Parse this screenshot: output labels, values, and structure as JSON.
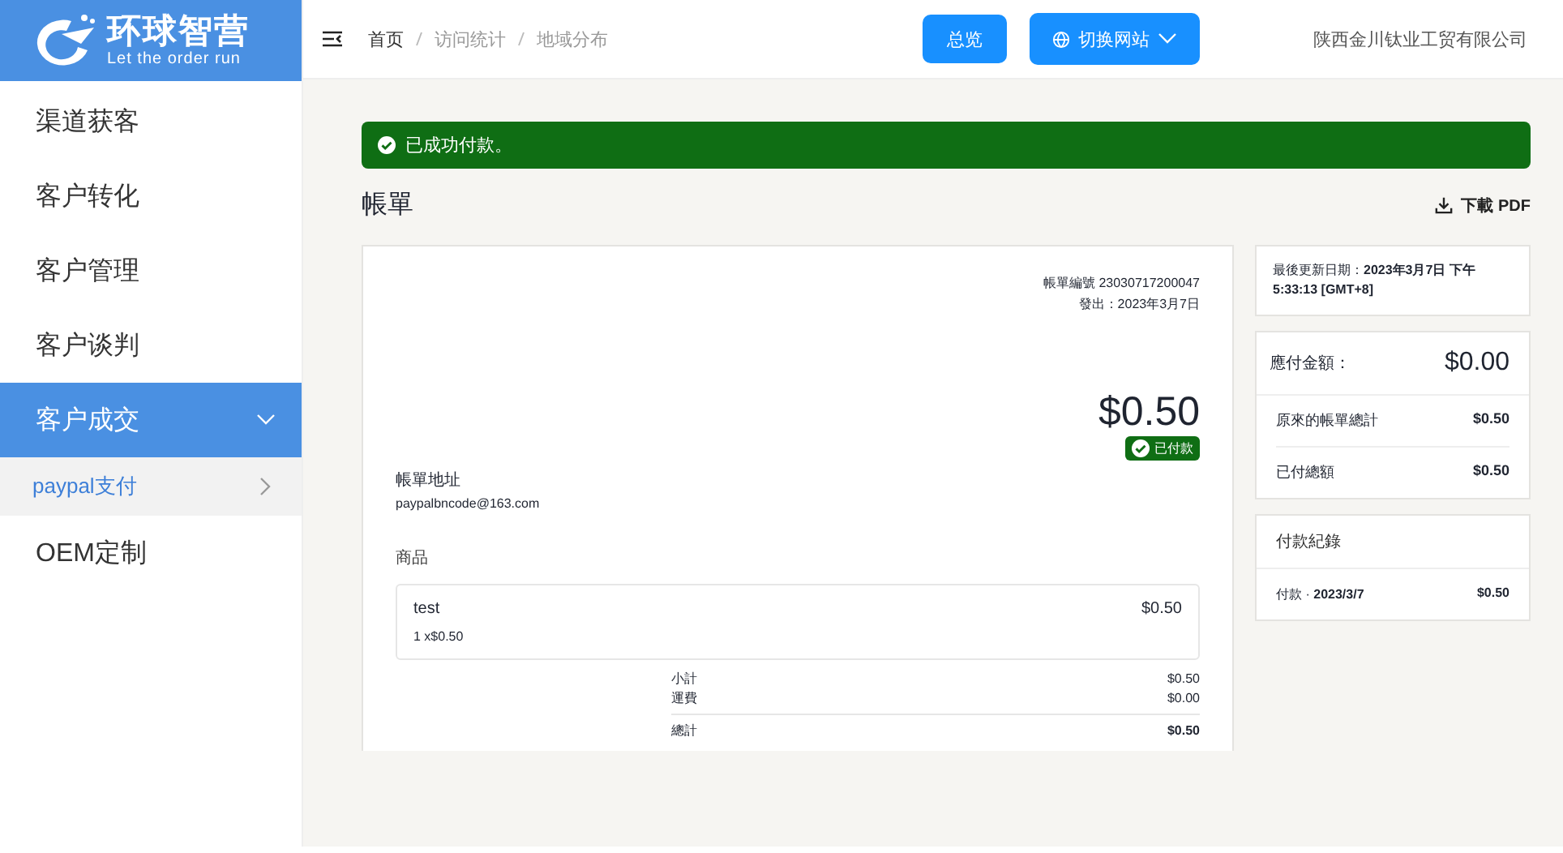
{
  "logo": {
    "title": "环球智营",
    "slogan": "Let the order run"
  },
  "sidebar": {
    "items": [
      {
        "label": "渠道获客",
        "selected": false
      },
      {
        "label": "客户转化",
        "selected": false
      },
      {
        "label": "客户管理",
        "selected": false
      },
      {
        "label": "客户谈判",
        "selected": false
      },
      {
        "label": "客户成交",
        "selected": true,
        "expanded": true,
        "children": [
          {
            "label": "paypal支付"
          }
        ]
      },
      {
        "label": "OEM定制",
        "selected": false
      }
    ]
  },
  "breadcrumb": [
    "首页",
    "访问统计",
    "地域分布"
  ],
  "header": {
    "overview_button": "总览",
    "switch_button": "切换网站",
    "company": "陕西金川钛业工贸有限公司"
  },
  "alert": "已成功付款。",
  "page_title": "帳單",
  "download": "下載 PDF",
  "invoice": {
    "number": "帳單編號 23030717200047",
    "issued": "發出：2023年3月7日",
    "amount": "$0.50",
    "status": "已付款",
    "address_label": "帳單地址",
    "email": "paypalbncode@163.com",
    "items_label": "商品",
    "items": [
      {
        "name": "test",
        "price": "$0.50",
        "qty": "1 x$0.50"
      }
    ],
    "totals": [
      {
        "label": "小計",
        "value": "$0.50",
        "bold": false
      },
      {
        "label": "運費",
        "value": "$0.00",
        "bold": false
      },
      {
        "label": "總計",
        "value": "$0.50",
        "bold": true
      }
    ]
  },
  "updated": {
    "label": "最後更新日期：",
    "value": "2023年3月7日 下午 5:33:13 [GMT+8]"
  },
  "due": {
    "label": "應付金額：",
    "value": "$0.00",
    "rows": [
      {
        "label": "原來的帳單總計",
        "value": "$0.50"
      },
      {
        "label": "已付總額",
        "value": "$0.50"
      }
    ]
  },
  "payments": {
    "title": "付款紀錄",
    "rows": [
      {
        "label": "付款 ·",
        "date": "2023/3/7",
        "value": "$0.50"
      }
    ]
  }
}
